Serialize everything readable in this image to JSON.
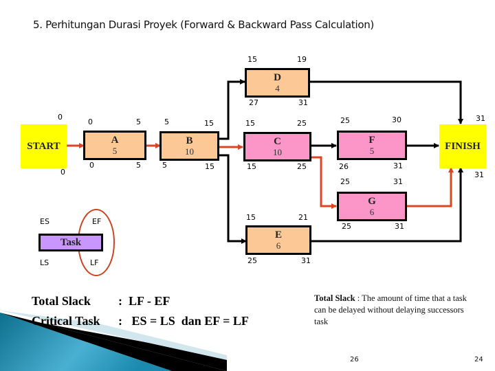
{
  "title": "5. Perhitungan Durasi Proyek (Forward & Backward Pass Calculation)",
  "colors": {
    "non_critical_task": "#fcc896",
    "critical_task": "#fc96c8",
    "milestone": "#ffff00",
    "legend_task": "#c896fc",
    "critical_path": "#dd4422",
    "normal_path": "#000000"
  },
  "nodes": {
    "start": {
      "label": "START",
      "es": "0",
      "ls": "0"
    },
    "finish": {
      "label": "FINISH",
      "ef": "31",
      "lf": "31"
    },
    "A": {
      "label": "A",
      "duration": "5",
      "es": "0",
      "ef": "5",
      "ls": "0",
      "lf": "5",
      "critical": true
    },
    "B": {
      "label": "B",
      "duration": "10",
      "es": "5",
      "ef": "15",
      "ls": "5",
      "lf": "15",
      "critical": true
    },
    "C": {
      "label": "C",
      "duration": "10",
      "es": "15",
      "ef": "25",
      "ls": "15",
      "lf": "25",
      "critical": true
    },
    "D": {
      "label": "D",
      "duration": "4",
      "es": "15",
      "ef": "19",
      "ls": "27",
      "lf": "31",
      "critical": false
    },
    "E": {
      "label": "E",
      "duration": "6",
      "es": "15",
      "ef": "21",
      "ls": "25",
      "lf": "31",
      "critical": false
    },
    "F": {
      "label": "F",
      "duration": "5",
      "es": "25",
      "ef": "30",
      "ls": "26",
      "lf": "31",
      "critical": false
    },
    "G": {
      "label": "G",
      "duration": "6",
      "es": "25",
      "ef": "31",
      "ls": "25",
      "lf": "31",
      "critical": true
    }
  },
  "legend": {
    "task_label": "Task",
    "es": "ES",
    "ef": "EF",
    "ls": "LS",
    "lf": "LF"
  },
  "rules": {
    "total_slack_label": "Total Slack",
    "total_slack_formula": ":  LF - EF",
    "critical_task_label": "Critical Task",
    "critical_task_formula": ":   ES = LS  dan EF = LF"
  },
  "definition": {
    "term": "Total Slack",
    "text": " : The amount of time that a task can be delayed without delaying successors task"
  },
  "page_numbers": {
    "left": "26",
    "right": "24"
  }
}
